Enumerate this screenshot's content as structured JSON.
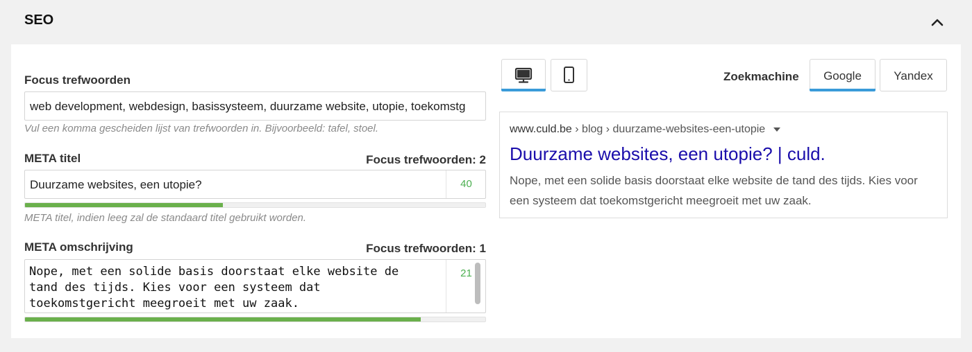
{
  "header": {
    "title": "SEO"
  },
  "focus": {
    "label": "Focus trefwoorden",
    "value": "web development, webdesign, basissysteem, duurzame website, utopie, toekomstg",
    "hint": "Vul een komma gescheiden lijst van trefwoorden in. Bijvoorbeeld: tafel, stoel."
  },
  "meta_title": {
    "label": "META titel",
    "focus_count": "Focus trefwoorden: 2",
    "value": "Duurzame websites, een utopie?",
    "counter": "40",
    "progress": 0.43,
    "hint": "META titel, indien leeg zal de standaard titel gebruikt worden."
  },
  "meta_desc": {
    "label": "META omschrijving",
    "focus_count": "Focus trefwoorden: 1",
    "value": "Nope, met een solide basis doorstaat elke website de\ntand des tijds. Kies voor een systeem dat\ntoekomstgericht meegroeit met uw zaak.",
    "counter": "21",
    "progress": 0.86
  },
  "preview": {
    "engine_label": "Zoekmachine",
    "engines": [
      "Google",
      "Yandex"
    ],
    "active_engine": "Google",
    "active_device": "desktop",
    "url_domain": "www.culd.be",
    "url_path": " › blog › duurzame-websites-een-utopie",
    "title": "Duurzame websites, een utopie? | culd.",
    "description": "Nope, met een solide basis doorstaat elke website de tand des tijds. Kies voor een systeem dat toekomstgericht meegroeit met uw zaak."
  },
  "colors": {
    "accent": "#3a9bd9",
    "progress": "#6ab04c",
    "counter": "#4caf50",
    "link": "#1a0dab"
  }
}
